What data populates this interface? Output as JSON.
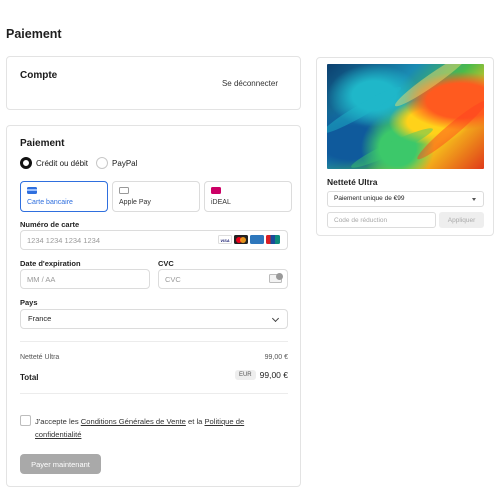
{
  "page": {
    "title": "Paiement"
  },
  "account": {
    "title": "Compte",
    "logout_label": "Se déconnecter"
  },
  "payment": {
    "title": "Paiement",
    "radio_options": [
      {
        "label": "Crédit ou débit",
        "selected": true
      },
      {
        "label": "PayPal",
        "selected": false
      }
    ],
    "methods": [
      {
        "label": "Carte bancaire",
        "icon": "credit-card-icon",
        "active": true
      },
      {
        "label": "Apple Pay",
        "icon": "apple-pay-icon",
        "active": false
      },
      {
        "label": "iDEAL",
        "icon": "ideal-icon",
        "active": false
      }
    ],
    "card_number": {
      "label": "Numéro de carte",
      "placeholder": "1234 1234 1234 1234",
      "brands": [
        "VISA",
        "Mastercard",
        "Amex",
        "UnionPay"
      ]
    },
    "expiry": {
      "label": "Date d'expiration",
      "placeholder": "MM / AA"
    },
    "cvc": {
      "label": "CVC",
      "placeholder": "CVC"
    },
    "country": {
      "label": "Pays",
      "value": "France"
    },
    "summary": {
      "line_item_label": "Netteté Ultra",
      "line_item_amount": "99,00 €",
      "total_label": "Total",
      "currency": "EUR",
      "total_amount": "99,00 €"
    },
    "terms": {
      "prefix": "J'accepte les ",
      "cgv_link": "Conditions Générales de Vente",
      "middle": " et la ",
      "privacy_link": "Politique de confidentialité"
    },
    "pay_button_label": "Payer maintenant"
  },
  "product": {
    "name": "Netteté Ultra",
    "plan_value": "Paiement unique de €99",
    "coupon_placeholder": "Code de réduction",
    "apply_label": "Appliquer"
  },
  "colors": {
    "accent": "#2f6fde",
    "button_disabled": "#a9a9a9",
    "border": "#dcdcdc"
  }
}
